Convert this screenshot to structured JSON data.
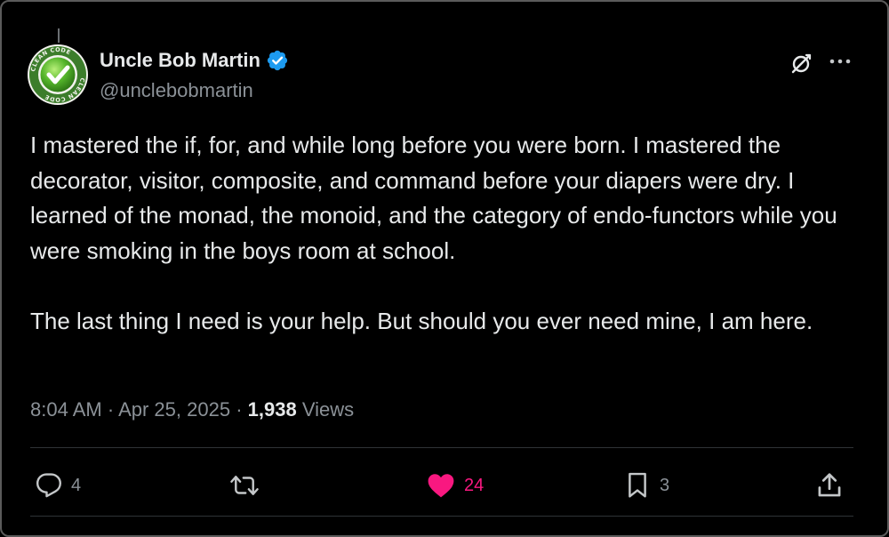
{
  "author": {
    "display_name": "Uncle Bob Martin",
    "handle": "@unclebobmartin",
    "verified": true,
    "avatar_icon": "clean-code-check-badge",
    "avatar_text": "CLEAN CODE"
  },
  "tweet": {
    "paragraphs": [
      "I mastered the if, for, and while long before you were born.  I mastered the decorator, visitor, composite, and command before your diapers were dry.  I learned of the monad, the monoid, and the category of endo-functors while you were smoking in the boys room at school.",
      "The last thing I need is your help.  But should you ever need mine, I am here."
    ],
    "time": "8:04 AM",
    "date": "Apr 25, 2025",
    "separator": "·",
    "views_count": "1,938",
    "views_label": "Views"
  },
  "actions": {
    "replies": "4",
    "retweets": "",
    "likes": "24",
    "bookmarks": "3"
  },
  "icons": {
    "grok": "grok-icon",
    "more": "more-dots-icon",
    "reply": "reply-icon",
    "retweet": "retweet-icon",
    "like": "heart-icon",
    "bookmark": "bookmark-icon",
    "share": "share-icon",
    "verified": "verified-badge-icon"
  },
  "colors": {
    "background": "#000000",
    "text": "#e7e9ea",
    "secondary": "#8b9197",
    "like": "#f91880",
    "verified": "#1d9bf0",
    "divider": "#2f3336"
  }
}
